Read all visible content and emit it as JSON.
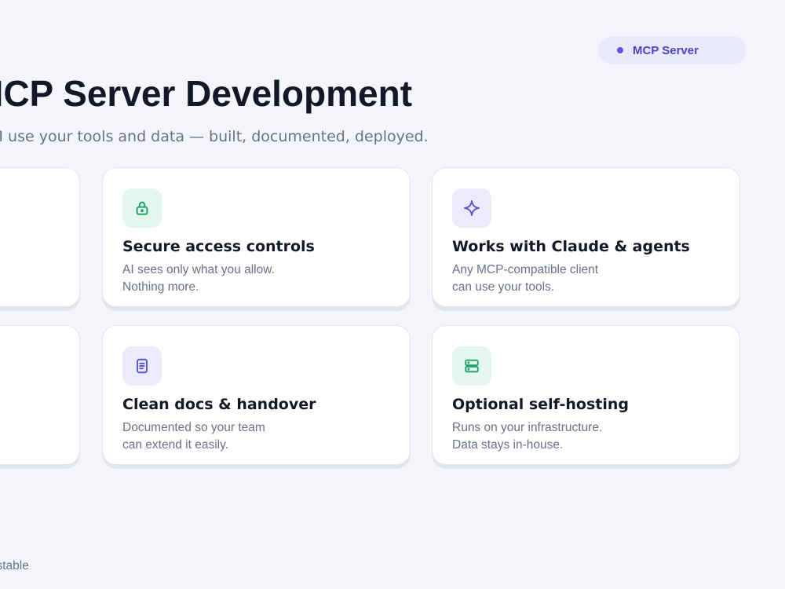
{
  "badge": {
    "label": "MCP Server"
  },
  "header": {
    "title": "MCP Server Development",
    "subtitle": "Let any AI use your tools and data — built, documented, deployed."
  },
  "cards": [
    {
      "icon": "plug-icon",
      "title": "",
      "lines": [
        "",
        ""
      ]
    },
    {
      "icon": "lock-icon",
      "title": "Secure access controls",
      "lines": [
        "AI sees only what you allow.",
        "Nothing more."
      ]
    },
    {
      "icon": "sparkle-icon",
      "title": "Works with Claude & agents",
      "lines": [
        "Any MCP-compatible client",
        "can use your tools."
      ]
    },
    {
      "icon": "code-icon",
      "title": "",
      "lines": [
        "",
        ""
      ]
    },
    {
      "icon": "document-icon",
      "title": "Clean docs & handover",
      "lines": [
        "Documented so your team",
        "can extend it easily."
      ]
    },
    {
      "icon": "server-icon",
      "title": "Optional self-hosting",
      "lines": [
        "Runs on your infrastructure.",
        "Data stays in-house."
      ]
    }
  ],
  "footer": {
    "text": "Claude & agents · Self-hostable"
  },
  "colors": {
    "accent": "#5a55d6",
    "green": "#22a36b",
    "background": "#f4f5fb",
    "text": "#141728",
    "muted": "#6a7089"
  }
}
